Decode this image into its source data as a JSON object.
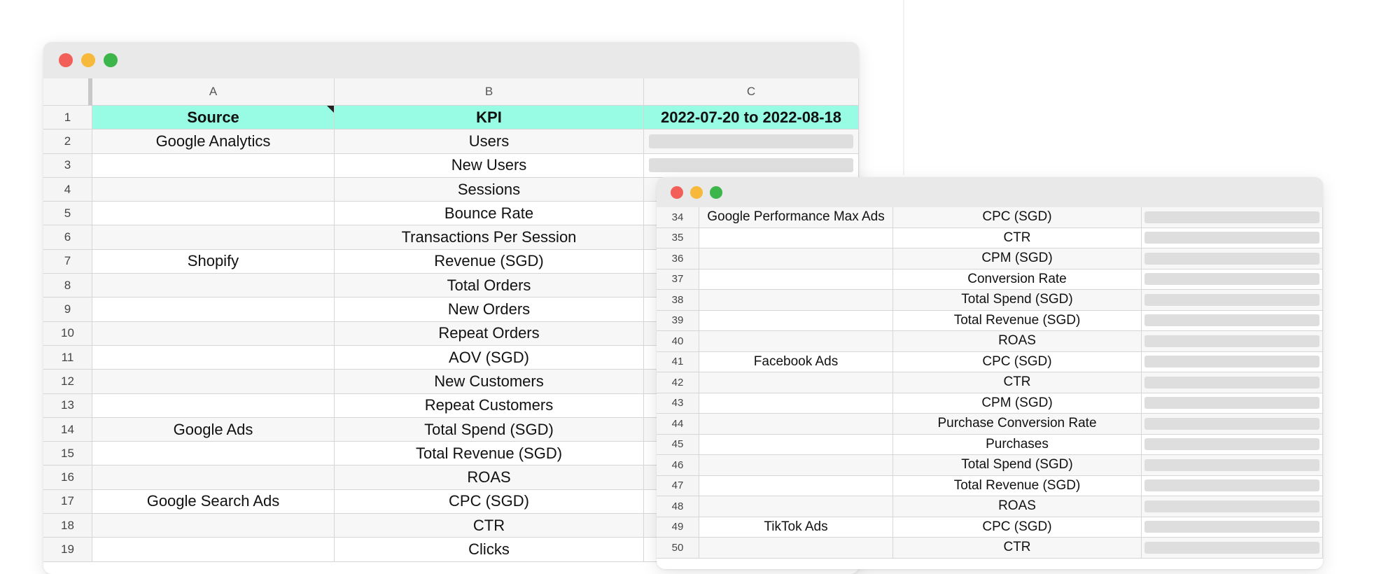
{
  "sheet1": {
    "columns": [
      "A",
      "B",
      "C"
    ],
    "header": {
      "row": "1",
      "source": "Source",
      "kpi": "KPI",
      "period": "2022-07-20 to 2022-08-18"
    },
    "rows": [
      {
        "num": "2",
        "source": "Google Analytics",
        "kpi": "Users"
      },
      {
        "num": "3",
        "source": "",
        "kpi": "New Users"
      },
      {
        "num": "4",
        "source": "",
        "kpi": "Sessions"
      },
      {
        "num": "5",
        "source": "",
        "kpi": "Bounce Rate"
      },
      {
        "num": "6",
        "source": "",
        "kpi": "Transactions Per Session"
      },
      {
        "num": "7",
        "source": "Shopify",
        "kpi": "Revenue (SGD)"
      },
      {
        "num": "8",
        "source": "",
        "kpi": "Total Orders"
      },
      {
        "num": "9",
        "source": "",
        "kpi": "New Orders"
      },
      {
        "num": "10",
        "source": "",
        "kpi": "Repeat Orders"
      },
      {
        "num": "11",
        "source": "",
        "kpi": "AOV (SGD)"
      },
      {
        "num": "12",
        "source": "",
        "kpi": "New Customers"
      },
      {
        "num": "13",
        "source": "",
        "kpi": "Repeat Customers"
      },
      {
        "num": "14",
        "source": "Google Ads",
        "kpi": "Total Spend (SGD)"
      },
      {
        "num": "15",
        "source": "",
        "kpi": "Total Revenue (SGD)"
      },
      {
        "num": "16",
        "source": "",
        "kpi": "ROAS"
      },
      {
        "num": "17",
        "source": "Google Search Ads",
        "kpi": "CPC (SGD)"
      },
      {
        "num": "18",
        "source": "",
        "kpi": "CTR"
      },
      {
        "num": "19",
        "source": "",
        "kpi": "Clicks"
      }
    ]
  },
  "sheet2": {
    "rows": [
      {
        "num": "34",
        "source": "Google Performance Max Ads",
        "kpi": "CPC (SGD)"
      },
      {
        "num": "35",
        "source": "",
        "kpi": "CTR"
      },
      {
        "num": "36",
        "source": "",
        "kpi": "CPM (SGD)"
      },
      {
        "num": "37",
        "source": "",
        "kpi": "Conversion Rate"
      },
      {
        "num": "38",
        "source": "",
        "kpi": "Total Spend (SGD)"
      },
      {
        "num": "39",
        "source": "",
        "kpi": "Total Revenue (SGD)"
      },
      {
        "num": "40",
        "source": "",
        "kpi": "ROAS"
      },
      {
        "num": "41",
        "source": "Facebook Ads",
        "kpi": "CPC (SGD)"
      },
      {
        "num": "42",
        "source": "",
        "kpi": "CTR"
      },
      {
        "num": "43",
        "source": "",
        "kpi": "CPM (SGD)"
      },
      {
        "num": "44",
        "source": "",
        "kpi": "Purchase Conversion Rate"
      },
      {
        "num": "45",
        "source": "",
        "kpi": "Purchases"
      },
      {
        "num": "46",
        "source": "",
        "kpi": "Total Spend (SGD)"
      },
      {
        "num": "47",
        "source": "",
        "kpi": "Total Revenue (SGD)"
      },
      {
        "num": "48",
        "source": "",
        "kpi": "ROAS"
      },
      {
        "num": "49",
        "source": "TikTok Ads",
        "kpi": "CPC (SGD)"
      },
      {
        "num": "50",
        "source": "",
        "kpi": "CTR"
      }
    ]
  },
  "colors": {
    "header_fill": "#98fbe3",
    "traffic_red": "#f25f58",
    "traffic_yellow": "#f6b93c",
    "traffic_green": "#3cb54a",
    "placeholder_bar": "#dedede"
  }
}
